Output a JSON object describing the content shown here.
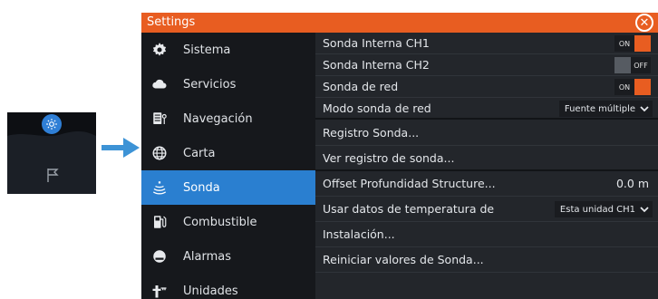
{
  "window": {
    "title": "Settings",
    "close_glyph": "✕"
  },
  "sidebar": {
    "items": [
      {
        "label": "Sistema",
        "icon": "gear-icon"
      },
      {
        "label": "Servicios",
        "icon": "cloud-icon"
      },
      {
        "label": "Navegación",
        "icon": "navigation-icon"
      },
      {
        "label": "Carta",
        "icon": "globe-icon"
      },
      {
        "label": "Sonda",
        "icon": "sonar-icon",
        "active": true
      },
      {
        "label": "Combustible",
        "icon": "fuel-pump-icon"
      },
      {
        "label": "Alarmas",
        "icon": "alarm-icon"
      },
      {
        "label": "Unidades",
        "icon": "units-icon"
      }
    ]
  },
  "main": {
    "rows": [
      {
        "label": "Sonda Interna CH1",
        "toggle": "ON"
      },
      {
        "label": "Sonda Interna CH2",
        "toggle": "OFF"
      },
      {
        "label": "Sonda de red",
        "toggle": "ON"
      },
      {
        "label": "Modo sonda de red",
        "dropdown": "Fuente múltiple"
      },
      {
        "label": "Registro Sonda..."
      },
      {
        "label": "Ver registro de sonda..."
      },
      {
        "label": "Offset Profundidad Structure...",
        "value": "0.0 m"
      },
      {
        "label": "Usar datos de temperatura de",
        "dropdown": "Esta unidad CH1"
      },
      {
        "label": "Instalación..."
      },
      {
        "label": "Reiniciar valores de Sonda..."
      }
    ]
  },
  "colors": {
    "accent": "#e85d21",
    "selection": "#2a7fd0",
    "panel": "#23262b",
    "sidebar": "#16181c"
  }
}
